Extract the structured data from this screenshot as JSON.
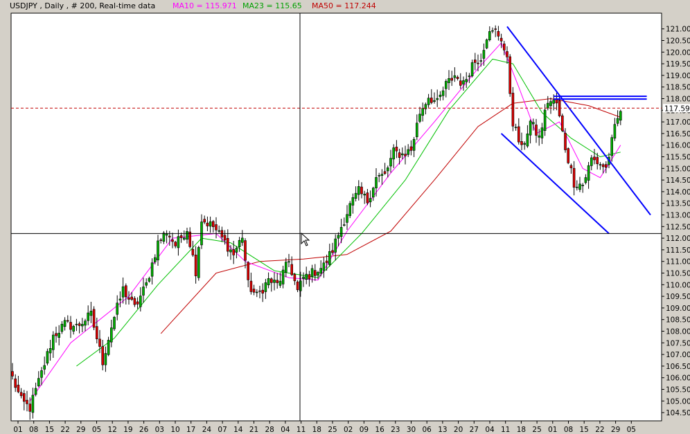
{
  "header": {
    "symbol_info": "USDJPY , Daily , # 200, Real-time data",
    "ma10_label": "MA10 = 115.971",
    "ma23_label": "MA23 = 115.65",
    "ma50_label": "MA50 = 117.244"
  },
  "colors": {
    "background": "#ffffff",
    "frame": "#d4d0c8",
    "up_candle": "#00b000",
    "down_candle": "#e00000",
    "ma10": "#ff00ff",
    "ma23": "#00c000",
    "ma50": "#c00000",
    "trendlines": "#0000ff",
    "current_price_line": "#c00000",
    "crosshair": "#000000"
  },
  "chart_data": {
    "type": "candlestick",
    "y_axis": {
      "min": 104.25,
      "max": 121.25,
      "ticks": [
        "121.00",
        "120.50",
        "120.00",
        "119.50",
        "119.00",
        "118.50",
        "118.00",
        "117.50",
        "117.00",
        "116.50",
        "116.00",
        "115.50",
        "115.00",
        "114.50",
        "114.00",
        "113.50",
        "113.00",
        "112.50",
        "112.00",
        "111.50",
        "111.00",
        "110.50",
        "110.00",
        "109.50",
        "109.00",
        "108.50",
        "108.00",
        "107.50",
        "107.00",
        "106.50",
        "106.00",
        "105.50",
        "105.00",
        "104.50"
      ]
    },
    "x_axis": {
      "ticks": [
        "01",
        "08",
        "15",
        "22",
        "29",
        "05",
        "12",
        "19",
        "26",
        "03",
        "10",
        "17",
        "24",
        "07",
        "14",
        "21",
        "28",
        "04",
        "11",
        "18",
        "25",
        "02",
        "09",
        "16",
        "23",
        "30",
        "06",
        "13",
        "20",
        "27",
        "04",
        "11",
        "18",
        "25",
        "01",
        "08",
        "15",
        "22",
        "29",
        "05"
      ]
    },
    "current_price": "117.59",
    "crosshair_price": 112.2,
    "series": [
      {
        "name": "MA10",
        "value": "115.971"
      },
      {
        "name": "MA23",
        "value": "115.65"
      },
      {
        "name": "MA50",
        "value": "117.244"
      }
    ],
    "keypoints": [
      {
        "i": 0,
        "price": 106.0
      },
      {
        "i": 3,
        "price": 105.0
      },
      {
        "i": 6,
        "price": 104.7
      },
      {
        "i": 10,
        "price": 106.2
      },
      {
        "i": 14,
        "price": 107.8
      },
      {
        "i": 18,
        "price": 108.3
      },
      {
        "i": 22,
        "price": 108.2
      },
      {
        "i": 27,
        "price": 108.7
      },
      {
        "i": 31,
        "price": 106.7
      },
      {
        "i": 34,
        "price": 108.2
      },
      {
        "i": 38,
        "price": 109.8
      },
      {
        "i": 42,
        "price": 109.0
      },
      {
        "i": 46,
        "price": 110.0
      },
      {
        "i": 50,
        "price": 111.8
      },
      {
        "i": 53,
        "price": 112.3
      },
      {
        "i": 56,
        "price": 111.7
      },
      {
        "i": 60,
        "price": 112.4
      },
      {
        "i": 63,
        "price": 110.6
      },
      {
        "i": 65,
        "price": 112.8
      },
      {
        "i": 69,
        "price": 112.5
      },
      {
        "i": 72,
        "price": 112.0
      },
      {
        "i": 76,
        "price": 111.3
      },
      {
        "i": 79,
        "price": 112.1
      },
      {
        "i": 81,
        "price": 110.0
      },
      {
        "i": 84,
        "price": 109.5
      },
      {
        "i": 88,
        "price": 110.2
      },
      {
        "i": 91,
        "price": 110.0
      },
      {
        "i": 95,
        "price": 111.0
      },
      {
        "i": 98,
        "price": 109.7
      },
      {
        "i": 100,
        "price": 110.3
      },
      {
        "i": 103,
        "price": 110.5
      },
      {
        "i": 107,
        "price": 110.8
      },
      {
        "i": 110,
        "price": 111.5
      },
      {
        "i": 113,
        "price": 112.5
      },
      {
        "i": 116,
        "price": 113.4
      },
      {
        "i": 119,
        "price": 114.0
      },
      {
        "i": 122,
        "price": 113.6
      },
      {
        "i": 125,
        "price": 114.6
      },
      {
        "i": 128,
        "price": 114.7
      },
      {
        "i": 131,
        "price": 115.7
      },
      {
        "i": 134,
        "price": 115.6
      },
      {
        "i": 137,
        "price": 115.8
      },
      {
        "i": 140,
        "price": 117.4
      },
      {
        "i": 143,
        "price": 118.1
      },
      {
        "i": 146,
        "price": 117.8
      },
      {
        "i": 149,
        "price": 118.6
      },
      {
        "i": 152,
        "price": 119.0
      },
      {
        "i": 155,
        "price": 118.6
      },
      {
        "i": 158,
        "price": 119.5
      },
      {
        "i": 161,
        "price": 119.8
      },
      {
        "i": 163,
        "price": 120.7
      },
      {
        "i": 166,
        "price": 120.9
      },
      {
        "i": 168,
        "price": 120.6
      },
      {
        "i": 170,
        "price": 119.6
      },
      {
        "i": 172,
        "price": 117.0
      },
      {
        "i": 175,
        "price": 115.8
      },
      {
        "i": 178,
        "price": 117.0
      },
      {
        "i": 181,
        "price": 116.3
      },
      {
        "i": 184,
        "price": 117.9
      },
      {
        "i": 187,
        "price": 117.8
      },
      {
        "i": 190,
        "price": 115.9
      },
      {
        "i": 193,
        "price": 114.4
      },
      {
        "i": 196,
        "price": 114.3
      },
      {
        "i": 199,
        "price": 115.4
      },
      {
        "i": 202,
        "price": 115.2
      },
      {
        "i": 204,
        "price": 115.0
      },
      {
        "i": 207,
        "price": 116.7
      },
      {
        "i": 209,
        "price": 117.5
      }
    ],
    "ma10_points": [
      [
        6,
        105.0
      ],
      [
        20,
        107.5
      ],
      [
        40,
        109.5
      ],
      [
        55,
        112.0
      ],
      [
        70,
        112.2
      ],
      [
        80,
        111.0
      ],
      [
        95,
        110.3
      ],
      [
        105,
        110.2
      ],
      [
        115,
        112.3
      ],
      [
        130,
        114.8
      ],
      [
        145,
        117.0
      ],
      [
        160,
        119.3
      ],
      [
        168,
        120.4
      ],
      [
        174,
        118.5
      ],
      [
        180,
        116.5
      ],
      [
        188,
        117.0
      ],
      [
        196,
        115.0
      ],
      [
        202,
        114.6
      ],
      [
        209,
        116.0
      ]
    ],
    "ma23_points": [
      [
        22,
        106.5
      ],
      [
        35,
        107.7
      ],
      [
        50,
        110.0
      ],
      [
        65,
        112.0
      ],
      [
        75,
        111.8
      ],
      [
        90,
        110.6
      ],
      [
        105,
        110.3
      ],
      [
        120,
        112.2
      ],
      [
        135,
        114.5
      ],
      [
        150,
        117.5
      ],
      [
        165,
        119.7
      ],
      [
        172,
        119.5
      ],
      [
        182,
        117.4
      ],
      [
        192,
        116.3
      ],
      [
        202,
        115.5
      ],
      [
        209,
        115.7
      ]
    ],
    "ma50_points": [
      [
        51,
        107.9
      ],
      [
        70,
        110.5
      ],
      [
        85,
        111.0
      ],
      [
        100,
        111.1
      ],
      [
        115,
        111.3
      ],
      [
        130,
        112.3
      ],
      [
        145,
        114.5
      ],
      [
        160,
        116.8
      ],
      [
        172,
        117.8
      ],
      [
        185,
        118.0
      ],
      [
        198,
        117.7
      ],
      [
        209,
        117.2
      ]
    ],
    "trendlines": [
      {
        "from": [
          170,
          121.1
        ],
        "to": [
          220,
          113.0
        ]
      },
      {
        "from": [
          168,
          116.5
        ],
        "to": [
          205,
          112.2
        ]
      },
      {
        "from": [
          186,
          118.1
        ],
        "to": [
          218,
          118.1
        ]
      }
    ]
  }
}
